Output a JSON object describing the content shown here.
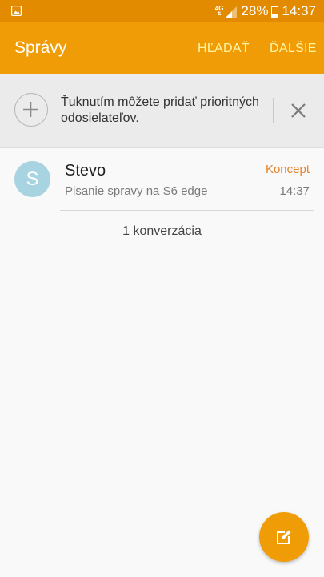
{
  "status_bar": {
    "network": "4G",
    "battery": "28%",
    "time": "14:37",
    "icons": [
      "gallery-icon",
      "signal-icon",
      "battery-icon"
    ]
  },
  "app_bar": {
    "title": "Správy",
    "search_label": "HĽADAŤ",
    "more_label": "ĎALŠIE"
  },
  "priority_banner": {
    "text": "Ťuknutím môžete pridať prioritných odosielateľov.",
    "icons": [
      "add-icon",
      "close-icon"
    ]
  },
  "conversations": [
    {
      "avatar_letter": "S",
      "name": "Stevo",
      "preview": "Pisanie spravy na S6 edge",
      "badge": "Koncept",
      "time": "14:37"
    }
  ],
  "conversation_count": "1 konverzácia",
  "fab": {
    "icon": "compose-icon"
  },
  "colors": {
    "status_bar": "#e28a00",
    "app_bar": "#f09c06",
    "action_text": "#fff6a8",
    "draft": "#e4832a",
    "avatar": "#a8d4e1"
  }
}
